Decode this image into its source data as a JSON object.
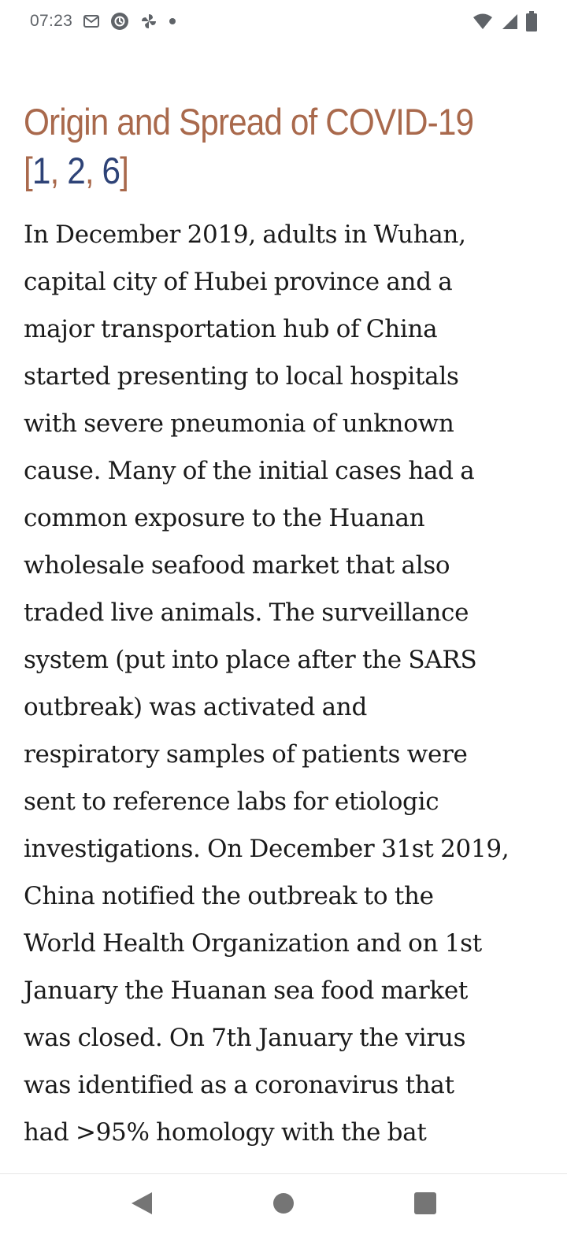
{
  "status_bar": {
    "time": "07:23",
    "left_icons": [
      "gmail-icon",
      "sync-badge-icon",
      "pinwheel-icon",
      "notification-dot-icon"
    ],
    "right_icons": [
      "wifi-icon",
      "cellular-signal-icon",
      "battery-icon"
    ]
  },
  "article": {
    "title_line1": "Origin and Spread of COVID-19",
    "title_open_bracket": "[",
    "citations": [
      "1",
      "2",
      "6"
    ],
    "citation_separator": ", ",
    "title_close_bracket": "]",
    "body_lines": [
      "In December 2019, adults in Wuhan,",
      "capital city of Hubei province and a",
      "major transportation hub of China",
      "started presenting to local hospitals",
      "with severe pneumonia of unknown",
      "cause. Many of the initial cases had a",
      "common exposure to the Huanan",
      "wholesale seafood market that also",
      "traded live animals. The surveillance",
      "system (put into place after the SARS",
      "outbreak) was activated and",
      "respiratory samples of patients were",
      "sent to reference labs for etiologic",
      "investigations. On December 31st 2019,",
      "China notified the outbreak to the",
      "World Health Organization and on 1st",
      "January the Huanan sea food market",
      "was closed. On 7th January the virus",
      "was identified as a coronavirus that",
      "had >95% homology with the bat"
    ]
  },
  "nav_bar": {
    "buttons": [
      "back",
      "home",
      "recents"
    ]
  },
  "colors": {
    "title": "#a9694c",
    "citation": "#2e4377",
    "body_text": "#1a1a1a",
    "status_icons": "#5f6368",
    "nav_icons": "#757575"
  }
}
